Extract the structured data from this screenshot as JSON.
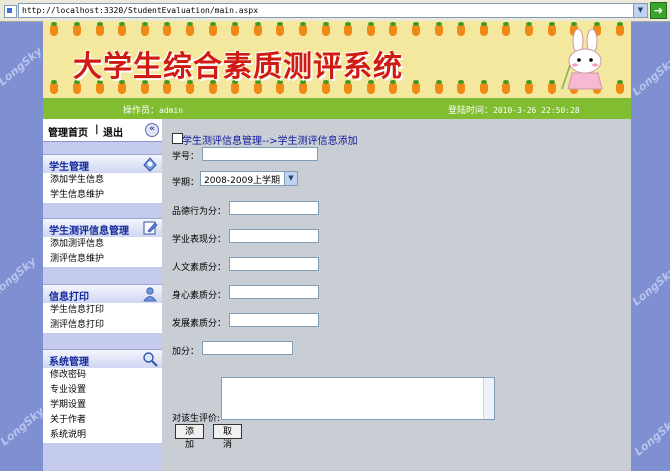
{
  "browser": {
    "url": "http://localhost:3320/StudentEvaluation/main.aspx"
  },
  "banner": {
    "title": "大学生综合素质测评系统"
  },
  "infobar": {
    "operator_label": "操作员：",
    "operator": "admin",
    "login_label": "登陆时间：",
    "login_time": "2010-3-26 22:50:28"
  },
  "sidebar": {
    "home": "管理首页",
    "separator": "|",
    "logout": "退出",
    "groups": [
      {
        "title": "学生管理",
        "icon": "students-icon",
        "items": [
          "添加学生信息",
          "学生信息维护"
        ]
      },
      {
        "title": "学生测评信息管理",
        "icon": "edit-icon",
        "items": [
          "添加测评信息",
          "测评信息维护"
        ]
      },
      {
        "title": "信息打印",
        "icon": "user-print-icon",
        "items": [
          "学生信息打印",
          "测评信息打印"
        ]
      },
      {
        "title": "系统管理",
        "icon": "search-icon",
        "items": [
          "修改密码",
          "专业设置",
          "学期设置",
          "关于作者",
          "系统说明"
        ]
      }
    ]
  },
  "main": {
    "breadcrumb": "学生测评信息管理-->学生测评信息添加",
    "form": {
      "student_id_label": "学号：",
      "semester_label": "学期：",
      "semester_value": "2008-2009上学期",
      "moral_label": "品德行为分：",
      "academic_label": "学业表现分：",
      "humanities_label": "人文素质分：",
      "physical_label": "身心素质分：",
      "development_label": "发展素质分：",
      "bonus_label": "加分：",
      "comment_label": "对该生评价:",
      "add_button": "添加",
      "cancel_button": "取消"
    }
  },
  "watermark": "LongSky"
}
